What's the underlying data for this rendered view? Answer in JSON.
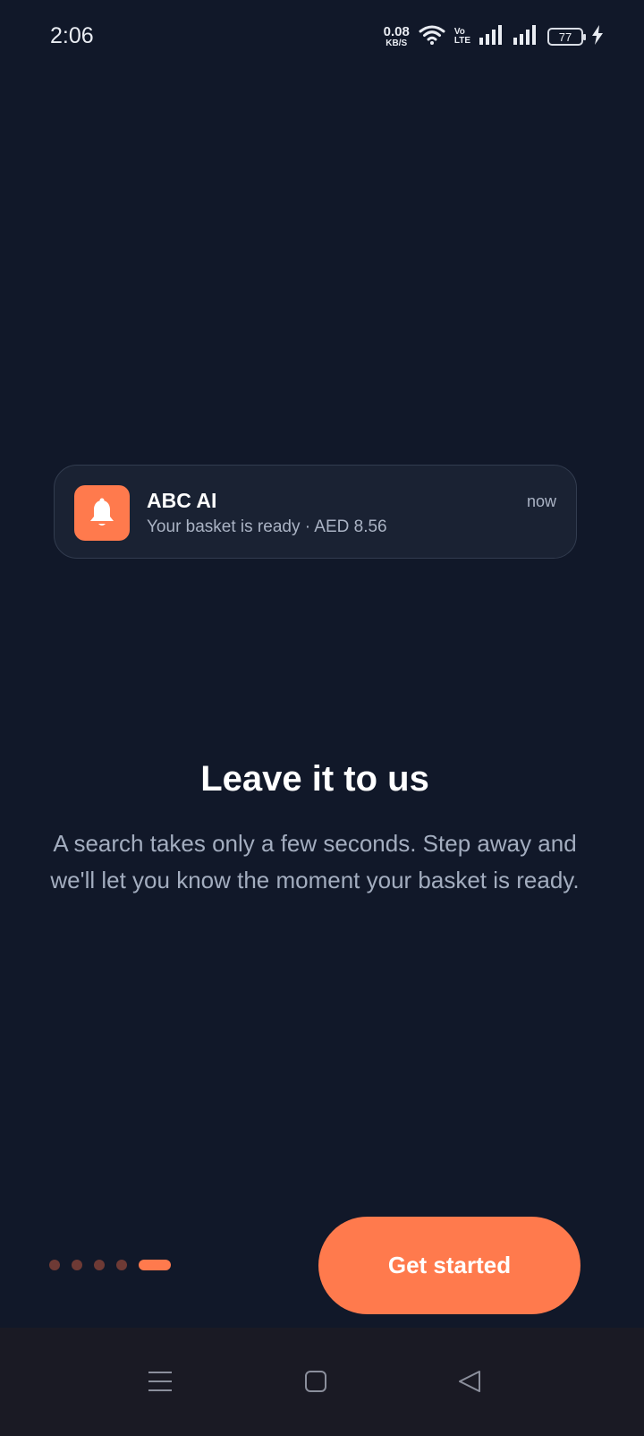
{
  "status_bar": {
    "time": "2:06",
    "net_speed_value": "0.08",
    "net_speed_unit": "KB/S",
    "volte_top": "Vo",
    "volte_bottom": "LTE",
    "battery_level": "77",
    "icons": [
      "wifi-icon",
      "signal-icon-sim1",
      "signal-icon-sim2",
      "battery-icon",
      "charging-icon"
    ]
  },
  "notification": {
    "app_name": "ABC AI",
    "message": "Your basket is ready · AED 8.56",
    "time": "now",
    "icon": "bell-icon"
  },
  "onboarding": {
    "headline": "Leave it to us",
    "description": "A search takes only a few seconds. Step away and we'll let you know the moment your basket is ready.",
    "page_count": 5,
    "current_page": 5
  },
  "cta": {
    "label": "Get started"
  },
  "nav_bar": {
    "icons": [
      "menu-icon",
      "home-icon",
      "back-icon"
    ]
  },
  "colors": {
    "background": "#111829",
    "accent": "#ff7a4d",
    "card": "#1a2233",
    "muted_text": "#a3adbf",
    "inactive_dot": "#6e3a35"
  }
}
